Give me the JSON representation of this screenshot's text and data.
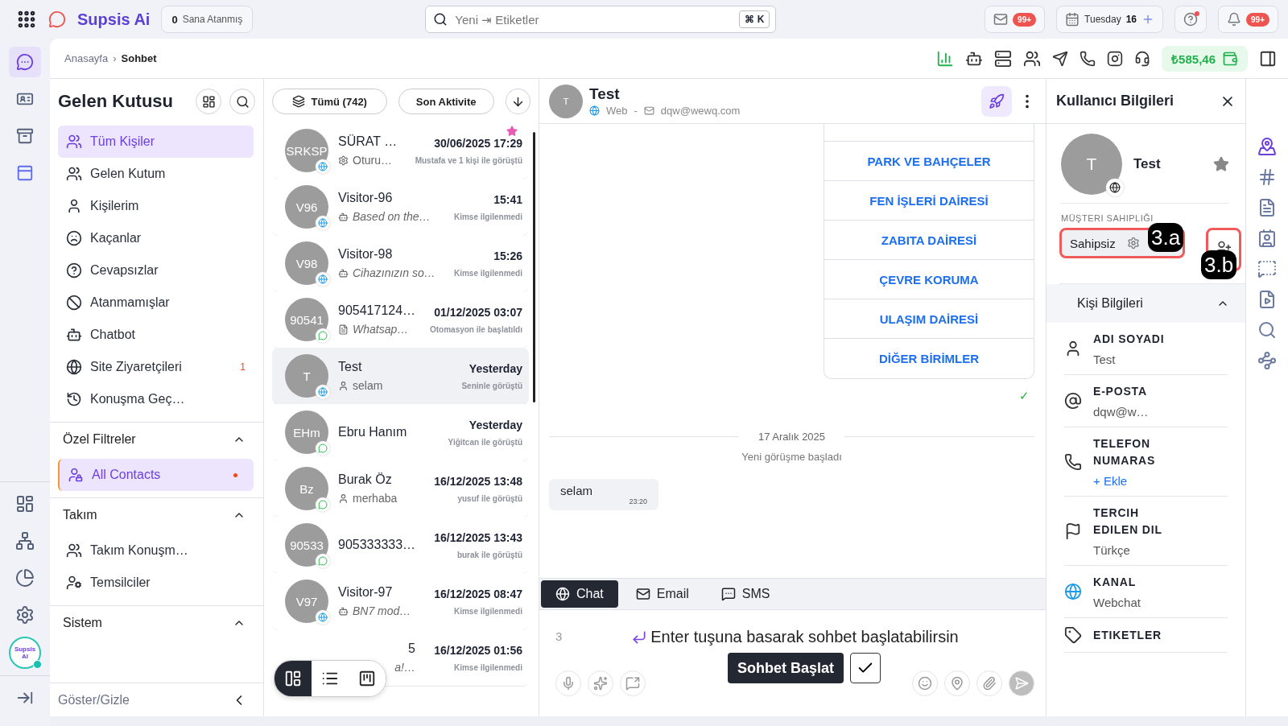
{
  "topbar": {
    "logo": "Supsis Ai",
    "assigned": {
      "count": "0",
      "label": "Sana Atanmış"
    },
    "search": {
      "placeholder": "Yeni ⇥ Etiketler",
      "shortcut": "⌘ K"
    },
    "mail_badge": "99+",
    "date": {
      "day": "Tuesday",
      "num": "16"
    },
    "help_dot": true,
    "bell_badge": "99+"
  },
  "breadcrumb": {
    "items": [
      "Anasayfa",
      "Sohbet"
    ],
    "separator": "›"
  },
  "toolbar": {
    "balance": "₺585,46"
  },
  "rail": {
    "top": [
      {
        "kind": "chat",
        "selected": true
      },
      {
        "kind": "card",
        "selected": false
      },
      {
        "kind": "archive",
        "selected": false
      },
      {
        "kind": "window",
        "selected": false
      }
    ],
    "logo_caption": "Supsis AI",
    "online": true
  },
  "inbox": {
    "title": "Gelen Kutusu",
    "items": [
      {
        "kind": "users",
        "label": "Tüm Kişiler",
        "selected": true
      },
      {
        "kind": "users",
        "label": "Gelen Kutum",
        "selected": false
      },
      {
        "kind": "user",
        "label": "Kişilerim",
        "selected": false
      },
      {
        "kind": "sad",
        "label": "Kaçanlar",
        "selected": false
      },
      {
        "kind": "help",
        "label": "Cevapsızlar",
        "selected": false
      },
      {
        "kind": "ban",
        "label": "Atanmamışlar",
        "selected": false
      },
      {
        "kind": "bot",
        "label": "Chatbot",
        "selected": false
      },
      {
        "kind": "globe",
        "label": "Site Ziyaretçileri",
        "selected": false,
        "badge": "1"
      },
      {
        "kind": "history",
        "label": "Konuşma Geç…",
        "selected": false
      }
    ],
    "sections": [
      {
        "title": "Özel Filtreler",
        "expanded": true,
        "items": [
          {
            "kind": "userslock",
            "label": "All Contacts",
            "selected": true,
            "dot": true
          }
        ]
      },
      {
        "title": "Takım",
        "expanded": true,
        "items": [
          {
            "kind": "users",
            "label": "Takım Konuşm…",
            "selected": false
          },
          {
            "kind": "agents",
            "label": "Temsilciler",
            "selected": false
          }
        ]
      },
      {
        "title": "Sistem",
        "expanded": true
      }
    ],
    "footer": "Göster/Gizle"
  },
  "conversations": {
    "filter": "Tümü (742)",
    "sort": "Son Aktivite",
    "items": [
      {
        "kind": "full",
        "initials": "SRKSP",
        "channel": {
          "kind": "web"
        },
        "name": "SÜRAT …",
        "preview": {
          "kind": "gear",
          "text": "Oturu…"
        },
        "time": "30/06/2025 17:29",
        "note": "Mustafa ve 1 kişi ile görüştü",
        "starred": true,
        "selected": false
      },
      {
        "kind": "full",
        "initials": "V96",
        "channel": {
          "kind": "web"
        },
        "name": "Visitor-96",
        "preview": {
          "kind": "bot",
          "text": "Based on the…"
        },
        "time": "15:41",
        "note": "Kimse ilgilenmedi",
        "starred": false,
        "selected": false
      },
      {
        "kind": "full",
        "initials": "V98",
        "channel": {
          "kind": "web"
        },
        "name": "Visitor-98",
        "preview": {
          "kind": "bot",
          "text": "Cihazınızın so…"
        },
        "time": "15:26",
        "note": "Kimse ilgilenmedi",
        "starred": false,
        "selected": false
      },
      {
        "kind": "full",
        "initials": "90541",
        "channel": {
          "kind": "whatsapp"
        },
        "name": "905417124…",
        "preview": {
          "kind": "doc",
          "text": "Whatsap…"
        },
        "time": "01/12/2025 03:07",
        "note": "Otomasyon ile başlatıldı",
        "starred": false,
        "selected": false
      },
      {
        "kind": "full",
        "initials": "T",
        "channel": {
          "kind": "web"
        },
        "name": "Test",
        "preview": {
          "kind": "person",
          "text": "selam"
        },
        "time": "Yesterday",
        "note": "Seninle görüştü",
        "starred": false,
        "selected": true
      },
      {
        "kind": "full",
        "initials": "EHm",
        "channel": {
          "kind": "whatsapp"
        },
        "name": "Ebru Hanım",
        "time": "Yesterday",
        "note": "Yiğitcan ile görüştü",
        "starred": false,
        "selected": false
      },
      {
        "kind": "full",
        "initials": "Bz",
        "channel": {
          "kind": "whatsapp"
        },
        "name": "Burak Öz",
        "preview": {
          "kind": "person",
          "text": "merhaba"
        },
        "time": "16/12/2025 13:48",
        "note": "yusuf ile görüştü",
        "starred": false,
        "selected": false
      },
      {
        "kind": "full",
        "initials": "90533",
        "channel": {
          "kind": "whatsapp"
        },
        "name": "905333333…",
        "time": "16/12/2025 13:43",
        "note": "burak ile görüştü",
        "starred": false,
        "selected": false
      },
      {
        "kind": "full",
        "initials": "V97",
        "channel": {
          "kind": "web"
        },
        "name": "Visitor-97",
        "preview": {
          "kind": "bot",
          "text": "BN7 mod…"
        },
        "time": "16/12/2025 08:47",
        "note": "Kimse ilgilenmedi",
        "starred": false,
        "selected": false
      },
      {
        "kind": "partial",
        "name": "5",
        "preview": {
          "kind": "none",
          "text": "a!…"
        },
        "time": "16/12/2025 01:56",
        "note": "Kimse ilgilenmedi",
        "starred": false,
        "selected": false
      }
    ],
    "views": [
      {
        "kind": "cards",
        "selected": true
      },
      {
        "kind": "list",
        "selected": false
      },
      {
        "kind": "board",
        "selected": false
      }
    ]
  },
  "chat": {
    "name": "Test",
    "initial": "T",
    "channel": "Web",
    "separator": "-",
    "email": "dqw@wewq.com",
    "menu": [
      "PARK VE BAHÇELER",
      "FEN İŞLERİ DAİRESİ",
      "ZABITA DAİRESİ",
      "ÇEVRE KORUMA",
      "ULAŞIM DAİRESİ",
      "DİĞER BİRİMLER"
    ],
    "delivered": "✓",
    "date": "17 Aralık 2025",
    "event": "Yeni görüşme başladı",
    "message": {
      "text": "selam",
      "time": "23:20"
    },
    "tabs": [
      {
        "kind": "chat",
        "label": "Chat",
        "selected": true
      },
      {
        "kind": "email",
        "label": "Email",
        "selected": false
      },
      {
        "kind": "sms",
        "label": "SMS",
        "selected": false
      }
    ],
    "composer": {
      "line": "3",
      "hint": "Enter tuşuna basarak sohbet başlatabilirsin",
      "start": "Sohbet Başlat"
    }
  },
  "user": {
    "title": "Kullanıcı Bilgileri",
    "initial": "T",
    "name": "Test",
    "starred": false,
    "owner_label": "MÜŞTERI SAHIPLIĞI",
    "owner": "Sahipsiz",
    "annotations": [
      "3.a",
      "3.b"
    ],
    "section": {
      "title": "Kişi Bilgileri",
      "expanded": true
    },
    "fields": [
      {
        "kind": "person",
        "label": "ADI SOYADI",
        "value": "Test"
      },
      {
        "kind": "at",
        "label": "E-POSTA",
        "value": "dqw@w…"
      },
      {
        "kind": "phone",
        "label": "TELEFON NUMARAS",
        "action": "+ Ekle"
      },
      {
        "kind": "flag",
        "label": "TERCIH EDILEN DIL",
        "value": "Türkçe"
      },
      {
        "kind": "globe",
        "label": "KANAL",
        "value": "Webchat"
      },
      {
        "kind": "tag",
        "label": "ETIKETLER"
      }
    ]
  },
  "side_tools": [
    {
      "kind": "pin",
      "selected": true
    },
    {
      "kind": "hash",
      "selected": false
    },
    {
      "kind": "doc",
      "selected": false
    },
    {
      "kind": "contacts",
      "selected": false
    },
    {
      "kind": "bolt",
      "selected": false
    },
    {
      "kind": "video",
      "selected": false
    },
    {
      "kind": "search",
      "selected": false
    },
    {
      "kind": "graph",
      "selected": false
    }
  ]
}
